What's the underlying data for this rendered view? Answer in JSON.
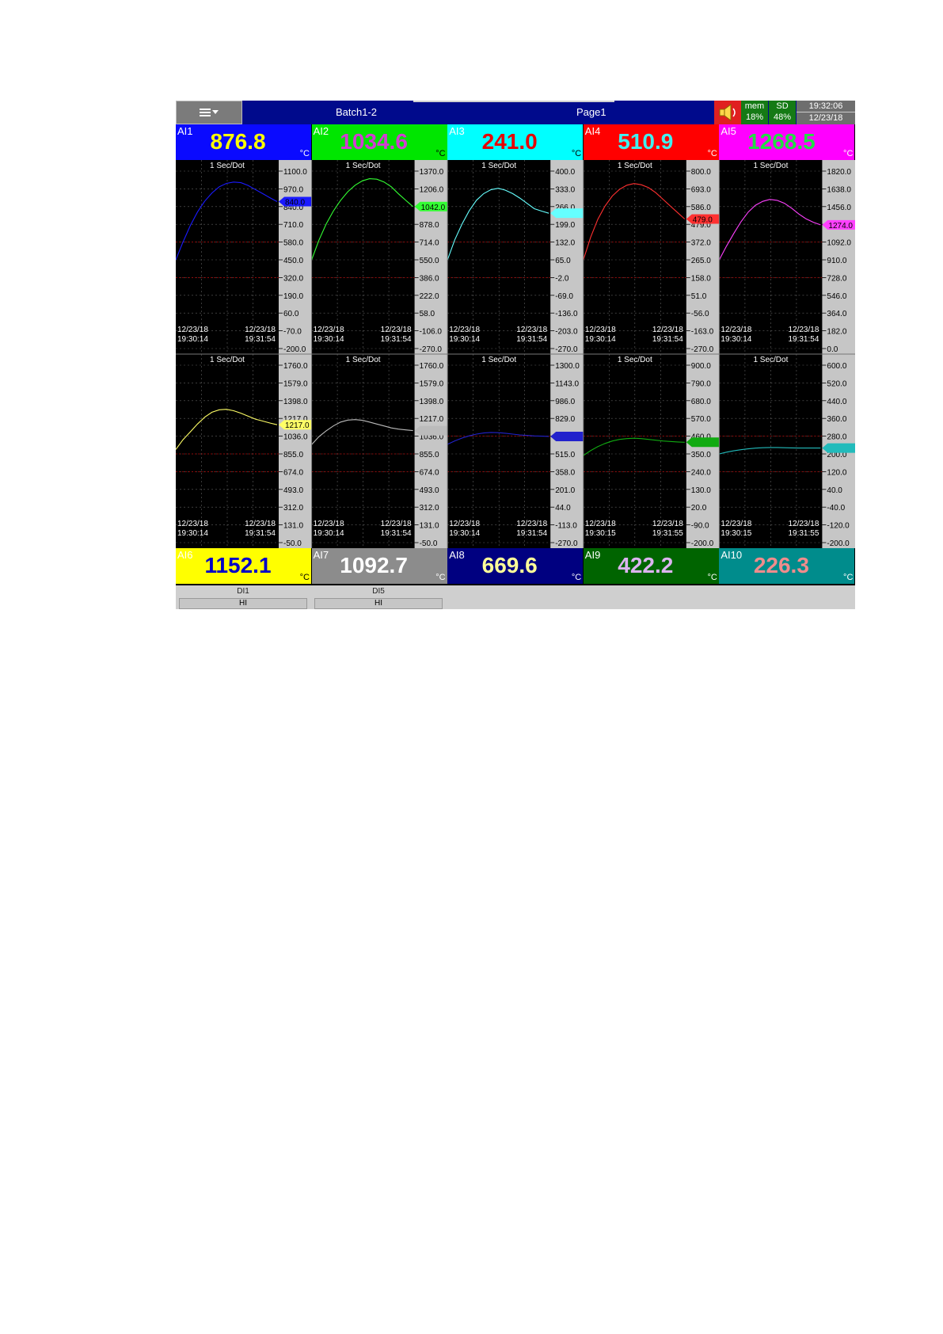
{
  "topbar": {
    "menu_icon": "hamburger-dropdown-icon",
    "batch_label": "Batch1-2",
    "page_label": "Page1",
    "speaker_icon": "speaker-icon",
    "mem_label": "mem",
    "mem_value": "18%",
    "sd_label": "SD",
    "sd_value": "48%",
    "time": "19:32:06",
    "date": "12/23/18"
  },
  "channels_top": [
    {
      "label": "AI1",
      "value": "876.8",
      "unit": "°C",
      "bg": "#0a0aff",
      "fg": "#ffff00"
    },
    {
      "label": "AI2",
      "value": "1034.6",
      "unit": "°C",
      "bg": "#00e600",
      "fg": "#d23cd2"
    },
    {
      "label": "AI3",
      "value": "241.0",
      "unit": "°C",
      "bg": "#00ffff",
      "fg": "#e60000"
    },
    {
      "label": "AI4",
      "value": "510.9",
      "unit": "°C",
      "bg": "#ff0000",
      "fg": "#40f0f0"
    },
    {
      "label": "AI5",
      "value": "1268.5",
      "unit": "°C",
      "bg": "#ff00ff",
      "fg": "#22dd44"
    }
  ],
  "channels_bottom": [
    {
      "label": "AI6",
      "value": "1152.1",
      "unit": "°C",
      "bg": "#ffff00",
      "fg": "#0000c8"
    },
    {
      "label": "AI7",
      "value": "1092.7",
      "unit": "°C",
      "bg": "#8c8c8c",
      "fg": "#ffffff"
    },
    {
      "label": "AI8",
      "value": "669.6",
      "unit": "°C",
      "bg": "#000080",
      "fg": "#ffff99"
    },
    {
      "label": "AI9",
      "value": "422.2",
      "unit": "°C",
      "bg": "#006400",
      "fg": "#dcb4f0"
    },
    {
      "label": "AI10",
      "value": "226.3",
      "unit": "°C",
      "bg": "#008c8c",
      "fg": "#f08c8c"
    }
  ],
  "digital_inputs": [
    {
      "name": "DI1",
      "state": "HI"
    },
    {
      "name": "DI5",
      "state": "HI"
    }
  ],
  "chart_data": [
    {
      "type": "line",
      "channel": "AI1",
      "rate_label": "1 Sec/Dot",
      "color": "#1a1aff",
      "ylim": [
        -200,
        1100
      ],
      "yticks": [
        "1100.0",
        "970.0",
        "840.0",
        "710.0",
        "580.0",
        "450.0",
        "320.0",
        "190.0",
        "60.0",
        "-70.0",
        "-200.0"
      ],
      "x_start": [
        "12/23/18",
        "19:30:14"
      ],
      "x_end": [
        "12/23/18",
        "19:31:54"
      ],
      "ref_lines": [
        580,
        320
      ],
      "current": 876.8,
      "current_label": "840.0",
      "y": [
        450,
        580,
        700,
        800,
        880,
        940,
        985,
        1010,
        1020,
        1015,
        995,
        965,
        935,
        905,
        876.8
      ]
    },
    {
      "type": "line",
      "channel": "AI2",
      "rate_label": "1 Sec/Dot",
      "color": "#33ff33",
      "ylim": [
        -270,
        1370
      ],
      "yticks": [
        "1370.0",
        "1206.0",
        "1042.0",
        "878.0",
        "714.0",
        "550.0",
        "386.0",
        "222.0",
        "58.0",
        "-106.0",
        "-270.0"
      ],
      "x_start": [
        "12/23/18",
        "19:30:14"
      ],
      "x_end": [
        "12/23/18",
        "19:31:54"
      ],
      "ref_lines": [
        714,
        386
      ],
      "current": 1042,
      "current_label": "1042.0",
      "y": [
        550,
        730,
        880,
        1000,
        1100,
        1180,
        1240,
        1280,
        1300,
        1295,
        1270,
        1225,
        1160,
        1100,
        1042
      ]
    },
    {
      "type": "line",
      "channel": "AI3",
      "rate_label": "1 Sec/Dot",
      "color": "#66ffff",
      "ylim": [
        -270,
        400
      ],
      "yticks": [
        "400.0",
        "333.0",
        "266.0",
        "199.0",
        "132.0",
        "65.0",
        "-2.0",
        "-69.0",
        "-136.0",
        "-203.0",
        "-270.0"
      ],
      "x_start": [
        "12/23/18",
        "19:30:14"
      ],
      "x_end": [
        "12/23/18",
        "19:31:54"
      ],
      "ref_lines": [
        132,
        -2
      ],
      "current": 241,
      "current_label": "",
      "y": [
        65,
        140,
        200,
        250,
        290,
        315,
        330,
        335,
        328,
        315,
        298,
        278,
        258,
        249,
        241
      ]
    },
    {
      "type": "line",
      "channel": "AI4",
      "rate_label": "1 Sec/Dot",
      "color": "#ff3030",
      "ylim": [
        -270,
        800
      ],
      "yticks": [
        "800.0",
        "693.0",
        "586.0",
        "479.0",
        "372.0",
        "265.0",
        "158.0",
        "51.0",
        "-56.0",
        "-163.0",
        "-270.0"
      ],
      "x_start": [
        "12/23/18",
        "19:30:14"
      ],
      "x_end": [
        "12/23/18",
        "19:31:54"
      ],
      "ref_lines": [
        372,
        158
      ],
      "current": 510.9,
      "current_label": "479.0",
      "y": [
        265,
        400,
        510,
        590,
        650,
        690,
        715,
        725,
        718,
        700,
        670,
        630,
        590,
        550,
        510.9
      ]
    },
    {
      "type": "line",
      "channel": "AI5",
      "rate_label": "1 Sec/Dot",
      "color": "#ff40ff",
      "ylim": [
        0,
        1820
      ],
      "yticks": [
        "1820.0",
        "1638.0",
        "1456.0",
        "1274.0",
        "1092.0",
        "910.0",
        "728.0",
        "546.0",
        "364.0",
        "182.0",
        "0.0"
      ],
      "x_start": [
        "12/23/18",
        "19:30:14"
      ],
      "x_end": [
        "12/23/18",
        "19:31:54"
      ],
      "ref_lines": [
        1092,
        728
      ],
      "current": 1268.5,
      "current_label": "1274.0",
      "y": [
        910,
        1050,
        1180,
        1300,
        1400,
        1470,
        1510,
        1530,
        1520,
        1490,
        1440,
        1380,
        1330,
        1295,
        1268.5
      ]
    },
    {
      "type": "line",
      "channel": "AI6",
      "rate_label": "1 Sec/Dot",
      "color": "#ffff66",
      "ylim": [
        -50,
        1760
      ],
      "yticks": [
        "1760.0",
        "1579.0",
        "1398.0",
        "1217.0",
        "1036.0",
        "855.0",
        "674.0",
        "493.0",
        "312.0",
        "131.0",
        "-50.0"
      ],
      "x_start": [
        "12/23/18",
        "19:30:14"
      ],
      "x_end": [
        "12/23/18",
        "19:31:54"
      ],
      "ref_lines": [
        855,
        674
      ],
      "current": 1152.1,
      "current_label": "1217.0",
      "y": [
        900,
        1000,
        1080,
        1160,
        1230,
        1280,
        1305,
        1310,
        1295,
        1270,
        1240,
        1210,
        1190,
        1170,
        1152.1
      ]
    },
    {
      "type": "line",
      "channel": "AI7",
      "rate_label": "1 Sec/Dot",
      "color": "#bbbbbb",
      "ylim": [
        -50,
        1760
      ],
      "yticks": [
        "1760.0",
        "1579.0",
        "1398.0",
        "1217.0",
        "1036.0",
        "855.0",
        "674.0",
        "493.0",
        "312.0",
        "131.0",
        "-50.0"
      ],
      "x_start": [
        "12/23/18",
        "19:30:14"
      ],
      "x_end": [
        "12/23/18",
        "19:31:54"
      ],
      "ref_lines": [
        855,
        674
      ],
      "current": 1092.7,
      "current_label": "",
      "y": [
        950,
        1030,
        1090,
        1140,
        1180,
        1200,
        1205,
        1198,
        1180,
        1160,
        1140,
        1120,
        1108,
        1100,
        1092.7
      ]
    },
    {
      "type": "line",
      "channel": "AI8",
      "rate_label": "1 Sec/Dot",
      "color": "#2222cc",
      "ylim": [
        -270,
        1300
      ],
      "yticks": [
        "1300.0",
        "1143.0",
        "986.0",
        "829.0",
        "672.0",
        "515.0",
        "358.0",
        "201.0",
        "44.0",
        "-113.0",
        "-270.0"
      ],
      "x_start": [
        "12/23/18",
        "19:30:14"
      ],
      "x_end": [
        "12/23/18",
        "19:31:54"
      ],
      "ref_lines": [
        672,
        358
      ],
      "current": 669.6,
      "current_label": "",
      "y": [
        600,
        630,
        655,
        675,
        690,
        700,
        705,
        703,
        698,
        690,
        683,
        678,
        674,
        672,
        669.6
      ]
    },
    {
      "type": "line",
      "channel": "AI9",
      "rate_label": "1 Sec/Dot",
      "color": "#11aa11",
      "ylim": [
        -200,
        900
      ],
      "yticks": [
        "900.0",
        "790.0",
        "680.0",
        "570.0",
        "460.0",
        "350.0",
        "240.0",
        "130.0",
        "20.0",
        "-90.0",
        "-200.0"
      ],
      "x_start": [
        "12/23/18",
        "19:30:15"
      ],
      "x_end": [
        "12/23/18",
        "19:31:55"
      ],
      "ref_lines": [
        460,
        240
      ],
      "current": 422.2,
      "current_label": "",
      "y": [
        340,
        370,
        395,
        415,
        430,
        440,
        445,
        447,
        445,
        440,
        435,
        430,
        427,
        424,
        422.2
      ]
    },
    {
      "type": "line",
      "channel": "AI10",
      "rate_label": "1 Sec/Dot",
      "color": "#22bbbb",
      "ylim": [
        -200,
        600
      ],
      "yticks": [
        "600.0",
        "520.0",
        "440.0",
        "360.0",
        "280.0",
        "200.0",
        "120.0",
        "40.0",
        "-40.0",
        "-120.0",
        "-200.0"
      ],
      "x_start": [
        "12/23/18",
        "19:30:15"
      ],
      "x_end": [
        "12/23/18",
        "19:31:55"
      ],
      "ref_lines": [
        280,
        120
      ],
      "current": 226.3,
      "current_label": "",
      "y": [
        200,
        208,
        214,
        219,
        223,
        226,
        228,
        229,
        229,
        228,
        227,
        226.5,
        226.4,
        226.3,
        226.3
      ]
    }
  ]
}
